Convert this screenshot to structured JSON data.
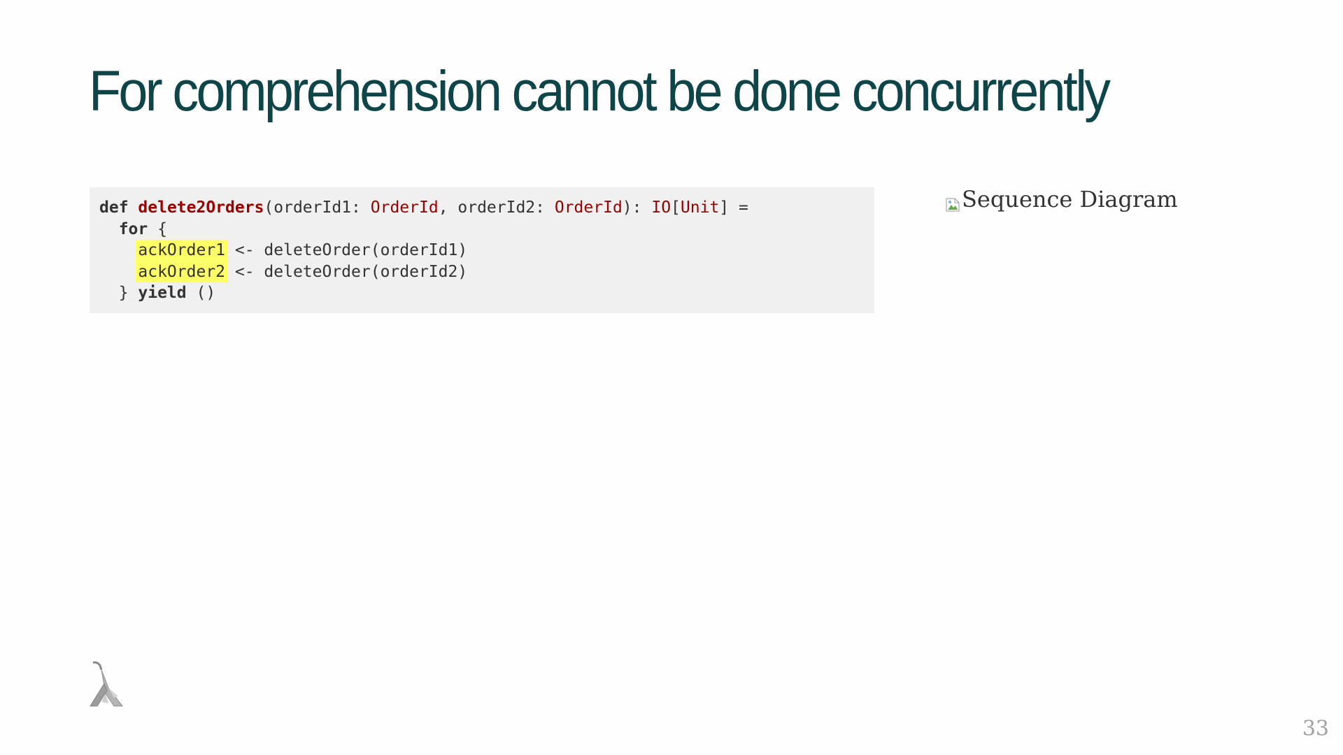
{
  "slide": {
    "title": "For comprehension cannot be done concurrently",
    "page_number": "33"
  },
  "code": {
    "line1": {
      "kw_def": "def",
      "fn_name": "delete2Orders",
      "p1": "(orderId1: ",
      "t1": "OrderId",
      "p2": ", orderId2: ",
      "t2": "OrderId",
      "p3": "): ",
      "t3": "IO",
      "p4": "[",
      "t4": "Unit",
      "p5": "] ="
    },
    "line2": {
      "indent": "  ",
      "kw_for": "for",
      "rest": " {"
    },
    "line3": {
      "indent": "    ",
      "highlight": "ackOrder1",
      "rest": " <- deleteOrder(orderId1)"
    },
    "line4": {
      "indent": "    ",
      "highlight": "ackOrder2",
      "rest": " <- deleteOrder(orderId2)"
    },
    "line5": {
      "indent": "  } ",
      "kw_yield": "yield",
      "rest": " ()"
    }
  },
  "diagram": {
    "alt_text": "Sequence Diagram",
    "icon": "broken-image-icon"
  },
  "logo": {
    "icon": "lambda-logo-icon"
  }
}
